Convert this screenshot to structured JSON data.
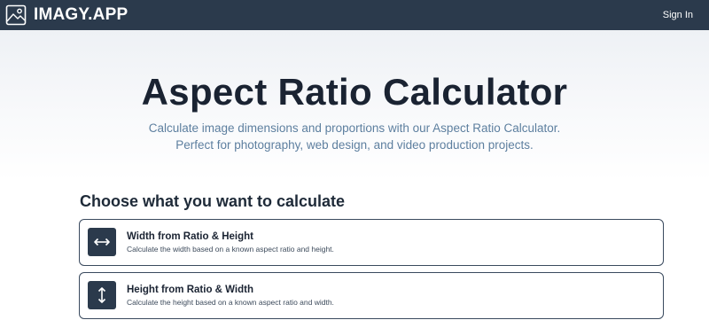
{
  "navbar": {
    "brand_name": "IMAGY.APP",
    "brand_icon": "image-icon",
    "sign_in_label": "Sign In",
    "background_color": "#2b3a4c"
  },
  "hero": {
    "title": "Aspect Ratio Calculator",
    "subtitle_line1": "Calculate image dimensions and proportions with our Aspect Ratio Calculator.",
    "subtitle_line2": "Perfect for photography, web design, and video production projects."
  },
  "main": {
    "section_heading": "Choose what you want to calculate",
    "options": [
      {
        "icon": "horizontal-arrows-icon",
        "title": "Width from Ratio & Height",
        "description": "Calculate the width based on a known aspect ratio and height."
      },
      {
        "icon": "vertical-arrows-icon",
        "title": "Height from Ratio & Width",
        "description": "Calculate the height based on a known aspect ratio and width."
      }
    ]
  },
  "colors": {
    "accent_dark": "#2b3a4c",
    "subtitle": "#5d7f9f",
    "heading": "#1a2332"
  }
}
